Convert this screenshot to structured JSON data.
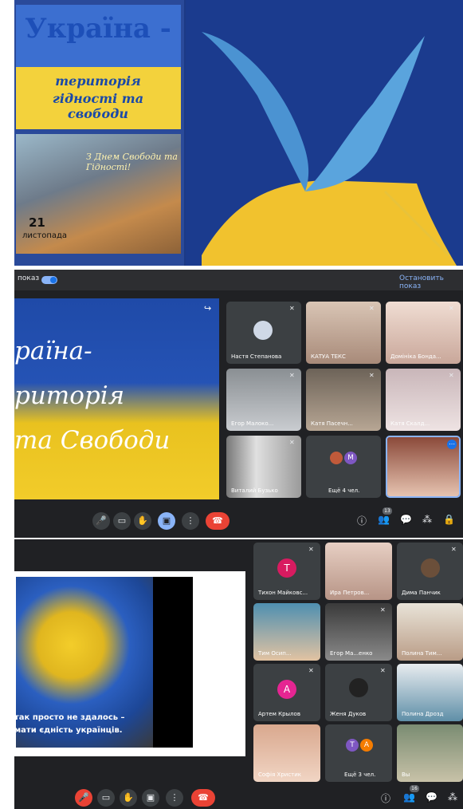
{
  "poster": {
    "title": "Україна -",
    "subtitle_line1": "територія",
    "subtitle_line2": "гідності та свободи",
    "photo_caption": "З Днем Свободи та Гідності!",
    "date_day": "21",
    "date_month": "листопада"
  },
  "meet1": {
    "topbar_label": "показ",
    "stop_button": "Остановить показ",
    "shared_lines": [
      "раїна-",
      "риторія",
      "та Свободи"
    ],
    "tiles": [
      {
        "name": "Настя Степанова",
        "type": "avatar-image"
      },
      {
        "name": "КАТУА ТЕКС",
        "type": "video"
      },
      {
        "name": "Домініка Бонда...",
        "type": "video"
      },
      {
        "name": "Егор Малоко...",
        "type": "video"
      },
      {
        "name": "Катя Пасечн...",
        "type": "video"
      },
      {
        "name": "Катя Скалд...",
        "type": "video"
      },
      {
        "name": "Виталий Бузько",
        "type": "video"
      },
      {
        "name": "Ещё 4 чел.",
        "type": "more",
        "initials": [
          "",
          "M"
        ]
      },
      {
        "name": "",
        "type": "video-active"
      }
    ],
    "controls": {
      "mic": "🎤",
      "camera": "▭",
      "hand": "✋",
      "present": "▣",
      "more": "⋮",
      "end": "☎"
    },
    "right_icons": {
      "info": "ⓘ",
      "people": "👥",
      "people_count": "13",
      "chat": "💬",
      "activities": "⁂",
      "lock": "🔒"
    }
  },
  "meet2": {
    "caption_line1": "так просто не здалось –",
    "caption_line2": "мати єдність українців.",
    "tiles": [
      {
        "name": "Тихон Майковс...",
        "type": "avatar",
        "initial": "Т",
        "color": "#d81b60"
      },
      {
        "name": "Ира Петров...",
        "type": "video"
      },
      {
        "name": "Дима Панчик",
        "type": "avatar-image"
      },
      {
        "name": "Тим Осип...",
        "type": "video"
      },
      {
        "name": "Егор Ма...енко",
        "type": "video"
      },
      {
        "name": "Полина Тим...",
        "type": "video"
      },
      {
        "name": "Артем Крылов",
        "type": "avatar",
        "initial": "А",
        "color": "#e52592"
      },
      {
        "name": "Женя Дуков",
        "type": "avatar-image"
      },
      {
        "name": "Полина Дрозд",
        "type": "video"
      },
      {
        "name": "Софія Христик",
        "type": "video"
      },
      {
        "name": "Ещё 3 чел.",
        "type": "more",
        "initials": [
          "Т",
          "А"
        ]
      },
      {
        "name": "Вы",
        "type": "video"
      }
    ],
    "right_icons": {
      "info": "ⓘ",
      "people": "👥",
      "people_count": "16",
      "chat": "💬",
      "activities": "⁂"
    }
  }
}
